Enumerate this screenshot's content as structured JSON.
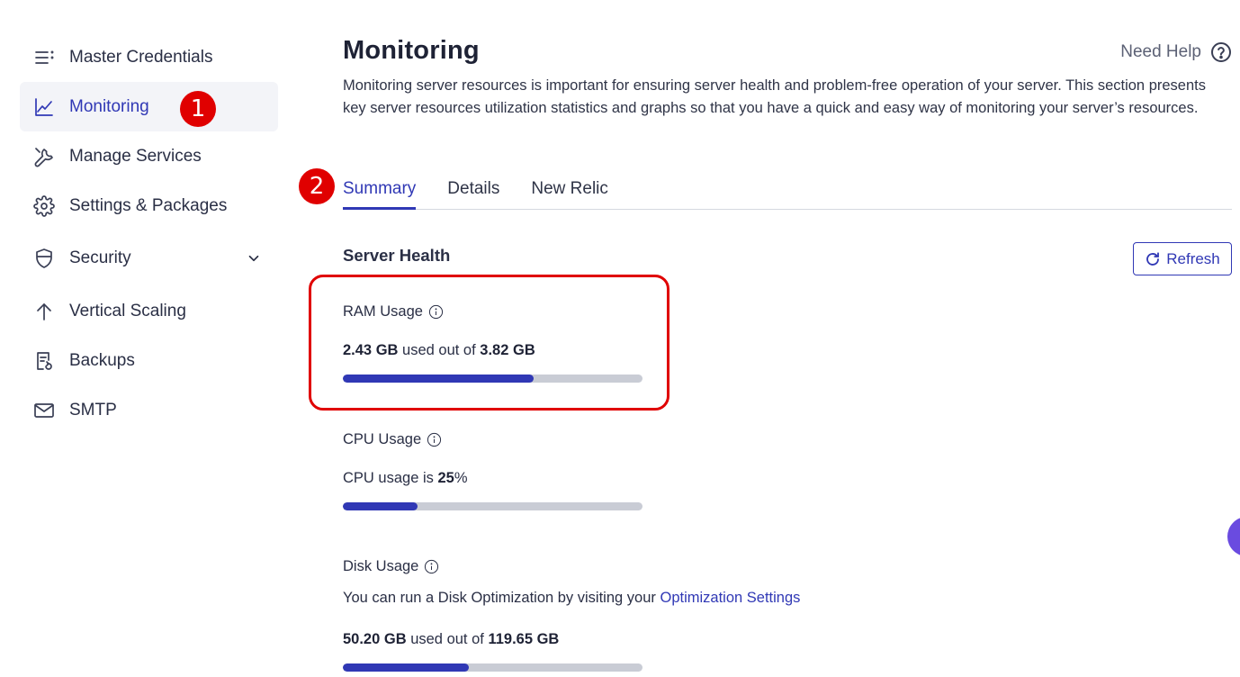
{
  "sidebar": {
    "items": [
      {
        "label": "Master Credentials",
        "icon": "list-icon"
      },
      {
        "label": "Monitoring",
        "icon": "chart-line-icon",
        "active": true
      },
      {
        "label": "Manage Services",
        "icon": "wrench-icon"
      },
      {
        "label": "Settings & Packages",
        "icon": "gear-icon"
      },
      {
        "label": "Security",
        "icon": "shield-icon",
        "expandable": true
      },
      {
        "label": "Vertical Scaling",
        "icon": "arrow-up-icon"
      },
      {
        "label": "Backups",
        "icon": "backup-icon"
      },
      {
        "label": "SMTP",
        "icon": "mail-icon"
      }
    ]
  },
  "markers": {
    "one": "1",
    "two": "2"
  },
  "header": {
    "title": "Monitoring",
    "help_label": "Need Help",
    "description": "Monitoring server resources is important for ensuring server health and problem-free operation of your server. This section presents key server resources utilization statistics and graphs so that you have a quick and easy way of monitoring your server’s resources."
  },
  "tabs": [
    {
      "label": "Summary",
      "active": true
    },
    {
      "label": "Details"
    },
    {
      "label": "New Relic"
    }
  ],
  "server_health": {
    "title": "Server Health",
    "refresh_label": "Refresh",
    "ram": {
      "title": "RAM Usage",
      "used": "2.43 GB",
      "middle": " used out of ",
      "total": "3.82 GB",
      "fraction": 0.636
    },
    "cpu": {
      "title": "CPU Usage",
      "prefix": "CPU usage is ",
      "value": "25",
      "suffix": "%",
      "fraction": 0.25
    },
    "disk": {
      "title": "Disk Usage",
      "hint_prefix": "You can run a Disk Optimization by visiting your ",
      "hint_link": "Optimization Settings",
      "used": "50.20 GB",
      "middle": " used out of ",
      "total": "119.65 GB",
      "fraction": 0.42
    }
  },
  "colors": {
    "accent": "#3038b5",
    "marker": "#e00000",
    "bar_track": "#c9ccd5"
  }
}
